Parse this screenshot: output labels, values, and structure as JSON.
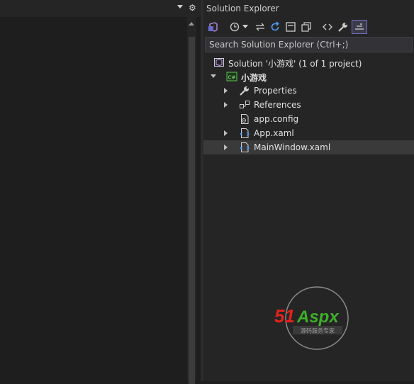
{
  "solution_explorer": {
    "title": "Solution Explorer",
    "search_placeholder": "Search Solution Explorer (Ctrl+;)",
    "toolbar": [
      {
        "name": "vs-solution-switch-icon"
      },
      {
        "name": "pending-changes-filter-icon"
      },
      {
        "name": "sync-icon"
      },
      {
        "name": "refresh-icon"
      },
      {
        "name": "collapse-all-icon"
      },
      {
        "name": "show-all-files-icon"
      },
      {
        "name": "view-code-icon"
      },
      {
        "name": "properties-icon"
      },
      {
        "name": "preview-selected-icon"
      }
    ],
    "tree": {
      "solution": "Solution '小游戏' (1 of 1 project)",
      "project": "小游戏",
      "items": [
        {
          "label": "Properties",
          "icon": "wrench-icon"
        },
        {
          "label": "References",
          "icon": "references-icon"
        },
        {
          "label": "app.config",
          "icon": "config-file-icon"
        },
        {
          "label": "App.xaml",
          "icon": "xaml-file-icon"
        },
        {
          "label": "MainWindow.xaml",
          "icon": "xaml-file-icon"
        }
      ]
    }
  },
  "watermark": {
    "brand": "51Aspx",
    "tagline": "源码服务专家"
  },
  "colors": {
    "accent": "#6f6fbf",
    "selection": "#3a3a3a",
    "watermark_red": "#e2231a",
    "watermark_green": "#3fae2a"
  }
}
